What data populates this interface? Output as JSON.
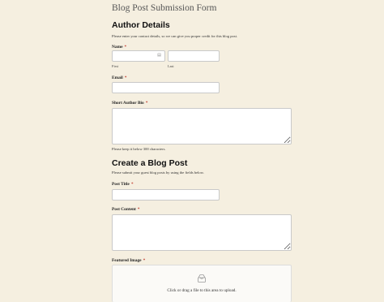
{
  "page": {
    "title": "Blog Post Submission Form"
  },
  "author": {
    "heading": "Author Details",
    "description": "Please enter your contact details, so we can give you proper credit for this blog post.",
    "name": {
      "label": "Name",
      "required_mark": "*",
      "first_sub": "First",
      "last_sub": "Last",
      "first_value": "",
      "last_value": ""
    },
    "email": {
      "label": "Email",
      "required_mark": "*",
      "value": ""
    },
    "bio": {
      "label": "Short Author Bio",
      "required_mark": "*",
      "value": "",
      "help": "Please keep it below 300 characters."
    }
  },
  "post": {
    "heading": "Create a Blog Post",
    "description": "Please submit your guest blog posts by using the fields below.",
    "title_field": {
      "label": "Post Title",
      "required_mark": "*",
      "value": ""
    },
    "content": {
      "label": "Post Content",
      "required_mark": "*",
      "value": ""
    },
    "image": {
      "label": "Featured Image",
      "required_mark": "*",
      "upload_text": "Click or drag a file to this area to upload.",
      "icon": "upload-icon"
    }
  },
  "colors": {
    "background": "#f5efe0",
    "required": "#c0392b",
    "border": "#c9c9c9"
  }
}
